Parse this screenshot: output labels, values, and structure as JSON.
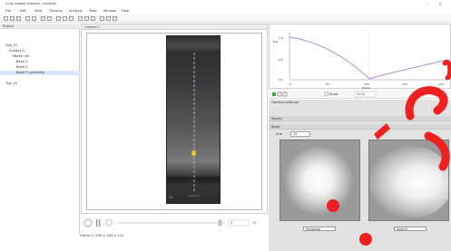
{
  "window": {
    "title": "x-ray motion analysis - tracking",
    "minimize_glyph": "–",
    "close_glyph": "x"
  },
  "menu": [
    "File",
    "Edit",
    "View",
    "Tracking",
    "Analysis",
    "Tools",
    "Window",
    "Help"
  ],
  "tree": {
    "header": "Project",
    "items": [
      {
        "label": "Trial_01",
        "selected": false
      },
      {
        "label": "Subject A",
        "selected": false
      },
      {
        "label": "Marker set",
        "selected": false
      },
      {
        "label": "Bead 1",
        "selected": false
      },
      {
        "label": "Bead 2",
        "selected": false
      },
      {
        "label": "Bead 3 (selected)",
        "selected": true
      },
      {
        "label": "Trial_02",
        "selected": false
      }
    ]
  },
  "viewer": {
    "header": "Camera 1",
    "corner_label": "C1",
    "playback": {
      "frame_value": "1",
      "readout": "12"
    },
    "status_text": "Frame 1 / 240   x: 104  y: 131"
  },
  "plot": {
    "y_label": "Pos",
    "y_ticks": [
      "1.0",
      "0.5",
      "0.0"
    ],
    "x_ticks": [
      "0",
      "50",
      "100",
      "150",
      "200"
    ],
    "x_label": "Frame"
  },
  "plot_toolbar": {
    "checkbox_label": "Show",
    "field_value": "0.00"
  },
  "lower": {
    "info_label": "Tracking settings:",
    "row1_label": "Region",
    "row2_label": "Bead",
    "field_label": "Size",
    "field_value": "15",
    "captions": [
      "Template",
      "Search"
    ]
  },
  "colors": {
    "accent_dots": "#ef2020",
    "track_line": "#c9a0dc",
    "selection": "#d9e6f7"
  }
}
